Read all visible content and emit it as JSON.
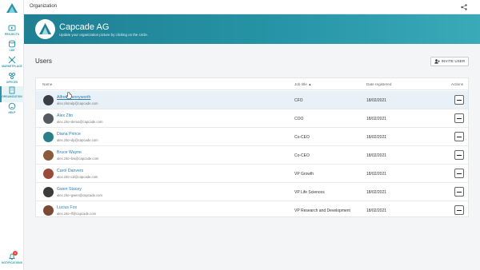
{
  "sidebar": {
    "items": [
      {
        "label": "PROJECTS",
        "icon": "projects-icon"
      },
      {
        "label": "CDE",
        "icon": "cde-icon"
      },
      {
        "label": "MARKETPLACE",
        "icon": "marketplace-icon"
      },
      {
        "label": "OFFICES",
        "icon": "offices-icon"
      },
      {
        "label": "ORGANIZATION",
        "icon": "organization-icon"
      },
      {
        "label": "HELP",
        "icon": "help-icon"
      }
    ],
    "notifications": {
      "label": "NOTIFICATIONS",
      "count": "1"
    }
  },
  "topbar": {
    "title": "Organization"
  },
  "banner": {
    "title": "Capcade AG",
    "subtitle": "Update your organization picture by clicking on the circle."
  },
  "users": {
    "title": "Users",
    "invite_label": "INVITE USER"
  },
  "table": {
    "columns": {
      "name": "Name",
      "job": "Job title ▲",
      "date": "Date registered",
      "actions": "Actions"
    },
    "rows": [
      {
        "name": "Alfred Pennyworth",
        "email": "alex.zitoralp@capcade.com",
        "job": "CFO",
        "date": "18/02/2021",
        "avatar_color": "#3b3f45"
      },
      {
        "name": "Alex Zito",
        "email": "alex.zito+demo@capcade.com",
        "job": "COO",
        "date": "18/02/2021",
        "avatar_color": "#555a60"
      },
      {
        "name": "Diana Prince",
        "email": "alex.zito+dp@capcade.com",
        "job": "Co-CEO",
        "date": "18/02/2021",
        "avatar_color": "#2c7d8a"
      },
      {
        "name": "Bruce Wayne",
        "email": "alex.zito+bw@capcade.com",
        "job": "Co-CEO",
        "date": "18/02/2021",
        "avatar_color": "#8a5a3c"
      },
      {
        "name": "Carol Danvers",
        "email": "alex.zito+cd@capcade.com",
        "job": "VP Growth",
        "date": "18/02/2021",
        "avatar_color": "#9a4a3a"
      },
      {
        "name": "Gwen Stacey",
        "email": "alex.zito+gwen@capcade.com",
        "job": "VP Life Sciences",
        "date": "18/02/2021",
        "avatar_color": "#3e3a38"
      },
      {
        "name": "Lucius Fox",
        "email": "alex.zito+lf@capcade.com",
        "job": "VP Research and Development",
        "date": "18/02/2021",
        "avatar_color": "#7a4a36"
      }
    ]
  }
}
